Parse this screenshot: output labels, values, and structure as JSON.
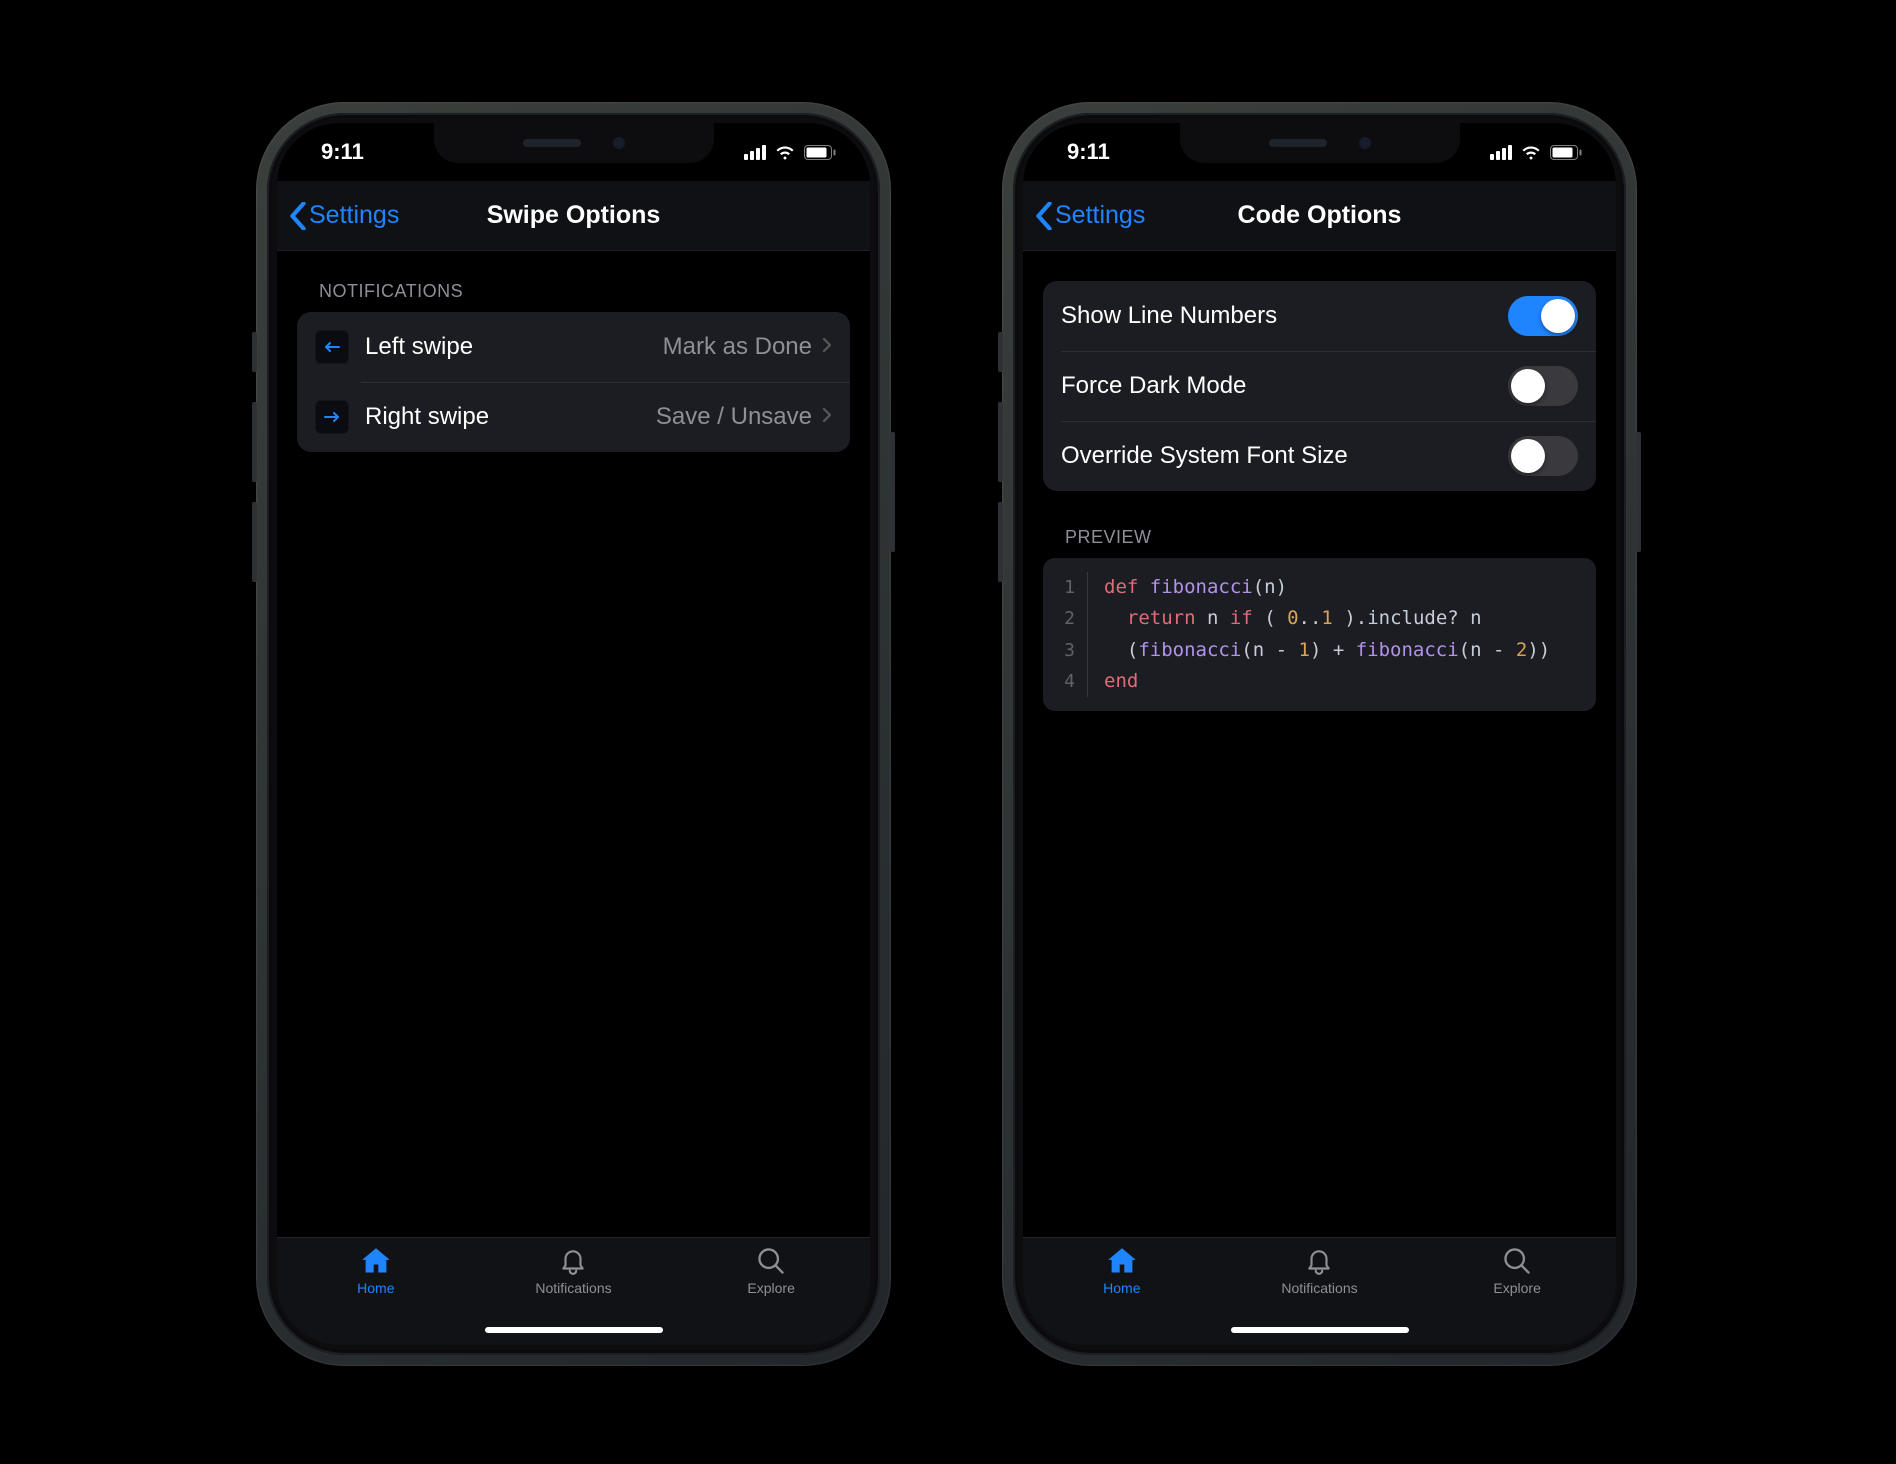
{
  "statusbar": {
    "time": "9:11"
  },
  "back_label": "Settings",
  "phone_left": {
    "title": "Swipe Options",
    "section_header": "NOTIFICATIONS",
    "rows": {
      "0": {
        "label": "Left swipe",
        "value": "Mark as Done"
      },
      "1": {
        "label": "Right swipe",
        "value": "Save / Unsave"
      }
    }
  },
  "phone_right": {
    "title": "Code Options",
    "toggles": {
      "0": {
        "label": "Show Line Numbers",
        "on": true
      },
      "1": {
        "label": "Force Dark Mode",
        "on": false
      },
      "2": {
        "label": "Override System Font Size",
        "on": false
      }
    },
    "preview_header": "PREVIEW",
    "code": {
      "lines": [
        "1",
        "2",
        "3",
        "4"
      ]
    }
  },
  "tabs": {
    "home": "Home",
    "notifications": "Notifications",
    "explore": "Explore"
  }
}
